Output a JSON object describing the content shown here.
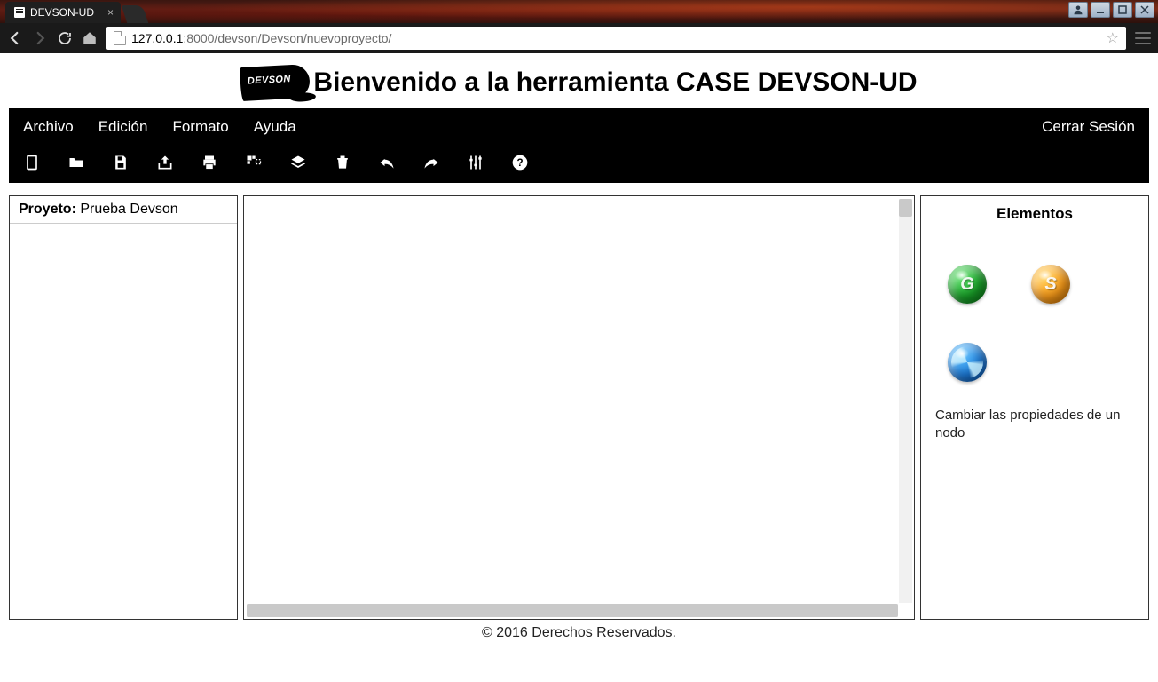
{
  "browser": {
    "tab_title": "DEVSON-UD",
    "url_host": "127.0.0.1",
    "url_port_path": ":8000/devson/Devson/nuevoproyecto/"
  },
  "header": {
    "logo_text": "DEVSON",
    "title": "Bienvenido a la herramienta CASE DEVSON-UD"
  },
  "menubar": {
    "items": [
      "Archivo",
      "Edición",
      "Formato",
      "Ayuda"
    ],
    "logout": "Cerrar Sesión"
  },
  "toolbar_icons": [
    "new-file-icon",
    "open-folder-icon",
    "save-icon",
    "export-icon",
    "print-icon",
    "grid-snap-icon",
    "layers-icon",
    "delete-icon",
    "undo-icon",
    "redo-icon",
    "settings-sliders-icon",
    "help-icon"
  ],
  "left_panel": {
    "project_label": "Proyeto:",
    "project_name": "Prueba Devson"
  },
  "right_panel": {
    "title": "Elementos",
    "hint": "Cambiar las propiedades de un nodo",
    "elements": [
      {
        "name": "element-green",
        "color": "green",
        "letter": "G"
      },
      {
        "name": "element-orange",
        "color": "orange",
        "letter": "S"
      },
      {
        "name": "element-blue",
        "color": "blue",
        "letter": ""
      }
    ]
  },
  "footer": "© 2016 Derechos Reservados."
}
